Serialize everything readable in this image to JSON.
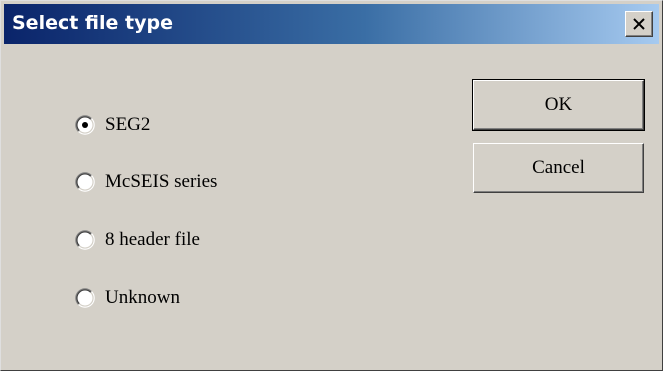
{
  "window": {
    "title": "Select file type",
    "close_glyph": "close-icon"
  },
  "file_type": {
    "options": [
      {
        "label": "SEG2",
        "selected": true
      },
      {
        "label": "McSEIS series",
        "selected": false
      },
      {
        "label": "8 header file",
        "selected": false
      },
      {
        "label": "Unknown",
        "selected": false
      }
    ]
  },
  "buttons": {
    "ok_label": "OK",
    "cancel_label": "Cancel"
  },
  "colors": {
    "dialog_face": "#d4d0c8",
    "title_active": "#0a246a",
    "title_gradient_end": "#a6caf0"
  }
}
